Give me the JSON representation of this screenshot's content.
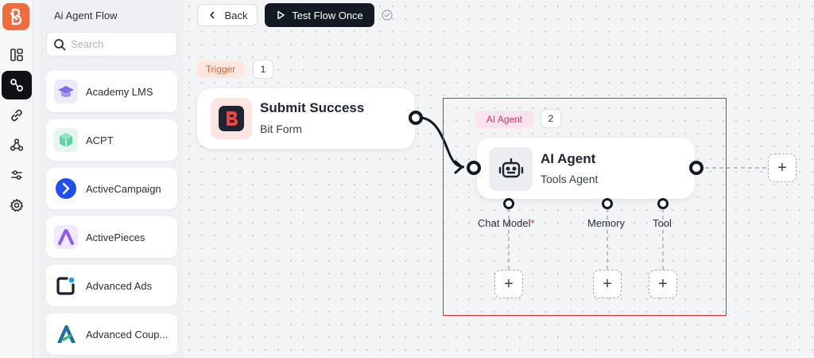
{
  "sidebar": {
    "title": "Ai Agent Flow",
    "search_placeholder": "Search",
    "apps": [
      {
        "label": "Academy LMS",
        "icon": "graduation-cap-icon"
      },
      {
        "label": "ACPT",
        "icon": "cube-icon"
      },
      {
        "label": "ActiveCampaign",
        "icon": "chevron-right-circle-icon"
      },
      {
        "label": "ActivePieces",
        "icon": "activepieces-logo-icon"
      },
      {
        "label": "Advanced Ads",
        "icon": "advanced-ads-logo-icon"
      },
      {
        "label": "Advanced Coup...",
        "icon": "advanced-coupons-logo-icon"
      }
    ]
  },
  "toolbar": {
    "back_label": "Back",
    "test_label": "Test Flow Once"
  },
  "trigger": {
    "badge": "Trigger",
    "step": "1",
    "title": "Submit Success",
    "subtitle": "Bit Form",
    "icon": "bit-form-logo-icon"
  },
  "agent": {
    "badge": "AI Agent",
    "step": "2",
    "title": "AI Agent",
    "subtitle": "Tools Agent",
    "icon": "robot-icon",
    "sub_nodes": [
      {
        "label": "Chat Model",
        "required_mark": "*"
      },
      {
        "label": "Memory"
      },
      {
        "label": "Tool"
      }
    ]
  },
  "plus_symbol": "+",
  "colors": {
    "brand": "#f26a3d",
    "dark": "#141a24",
    "trigger_badge": "#e0623b",
    "agent_badge": "#d6336c",
    "selection": "#e0282e"
  }
}
